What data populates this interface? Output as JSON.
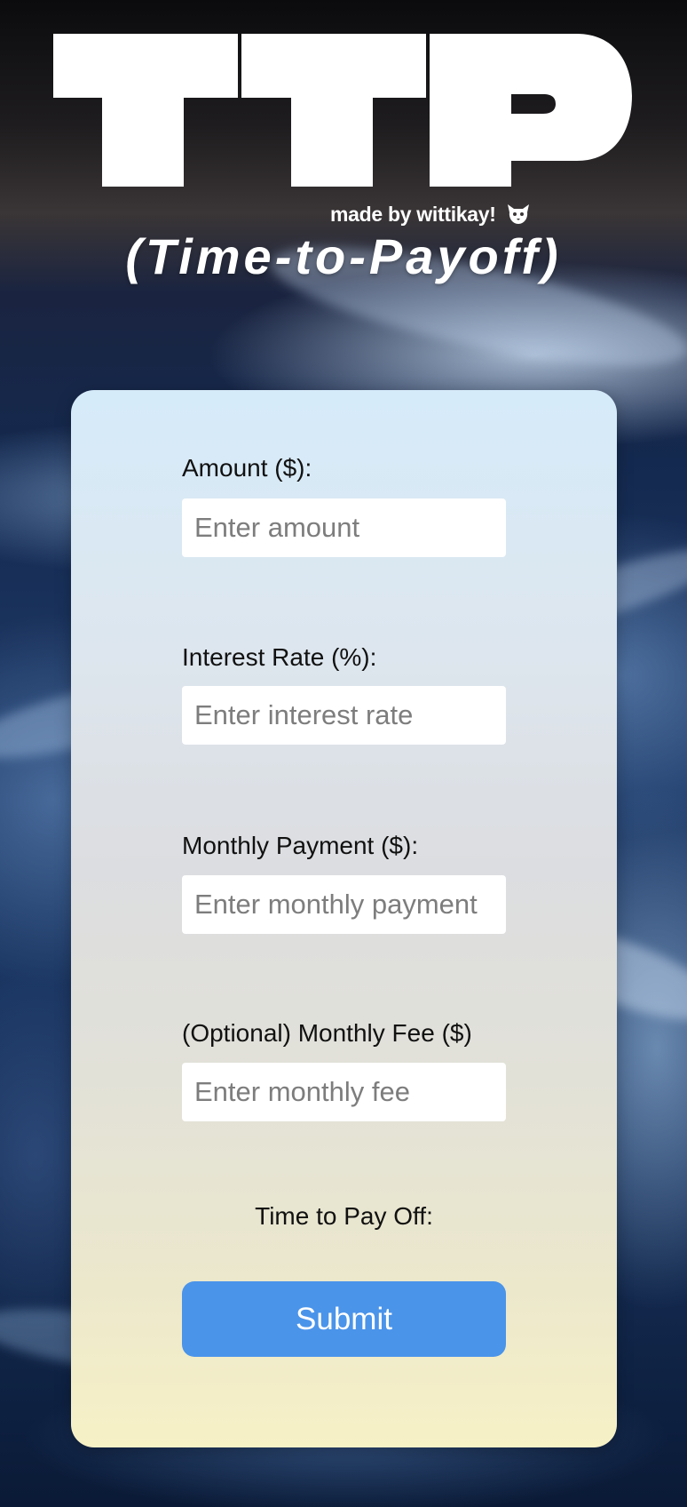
{
  "header": {
    "logo_text": "TTP",
    "credit": "made by wittikay!",
    "credit_icon": "cat-icon",
    "subtitle": "(Time-to-Payoff)"
  },
  "form": {
    "fields": [
      {
        "label": "Amount ($):",
        "placeholder": "Enter amount",
        "value": ""
      },
      {
        "label": "Interest Rate (%):",
        "placeholder": "Enter interest rate",
        "value": ""
      },
      {
        "label": "Monthly Payment ($):",
        "placeholder": "Enter monthly payment",
        "value": ""
      },
      {
        "label": "(Optional) Monthly Fee ($)",
        "placeholder": "Enter monthly fee",
        "value": ""
      }
    ],
    "result_label": "Time to Pay Off:",
    "submit_label": "Submit"
  },
  "colors": {
    "button": "#4a94ea",
    "card_top": "#d6ebfa",
    "card_bottom": "#f7f1c6"
  }
}
